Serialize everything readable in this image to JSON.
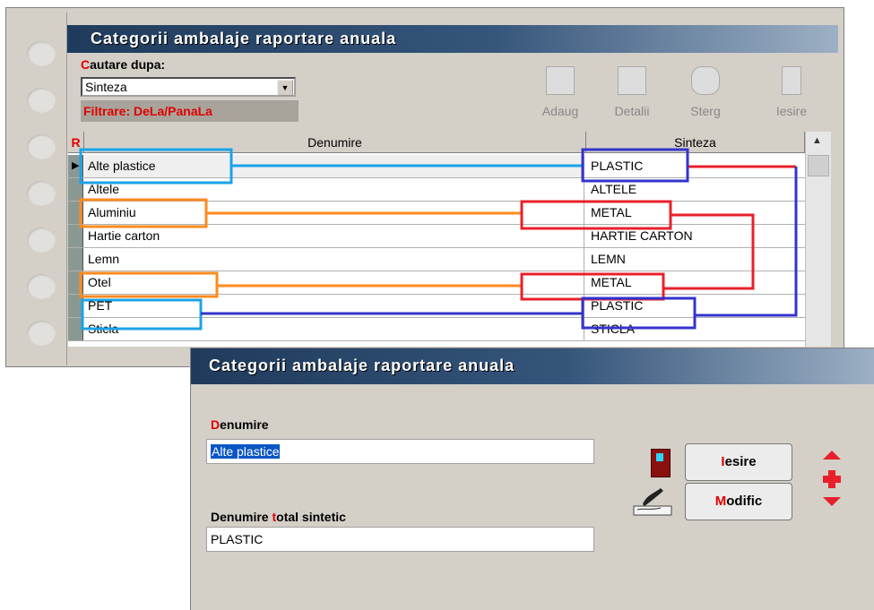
{
  "list_window": {
    "title": "Categorii ambalaje raportare anuala",
    "search": {
      "label_hot": "C",
      "label_rest": "autare dupa:",
      "selected": "Sinteza",
      "filter": "Filtrare: DeLa/PanaLa"
    },
    "toolbar": {
      "add": "Adaug",
      "details": "Detalii",
      "delete": "Sterg",
      "exit": "Iesire"
    },
    "grid": {
      "columns": {
        "mark": "R",
        "name": "Denumire",
        "synth": "Sinteza"
      },
      "rows": [
        {
          "name": "Alte plastice",
          "synth": "PLASTIC"
        },
        {
          "name": "Altele",
          "synth": "ALTELE"
        },
        {
          "name": "Aluminiu",
          "synth": "METAL"
        },
        {
          "name": "Hartie carton",
          "synth": "HARTIE CARTON"
        },
        {
          "name": "Lemn",
          "synth": "LEMN"
        },
        {
          "name": "Otel",
          "synth": "METAL"
        },
        {
          "name": "PET",
          "synth": "PLASTIC"
        },
        {
          "name": "Sticla",
          "synth": "STICLA"
        }
      ]
    }
  },
  "edit_window": {
    "title": "Categorii ambalaje raportare anuala",
    "name_label_hot": "D",
    "name_label_rest": "enumire",
    "name_value": "Alte plastice",
    "synth_label_a": "Denumire ",
    "synth_label_hot": "t",
    "synth_label_b": "otal sintetic",
    "synth_value": "PLASTIC",
    "btn_exit_hot": "I",
    "btn_exit_rest": "esire",
    "btn_modify_hot": "M",
    "btn_modify_rest": "odific"
  },
  "colors": {
    "annotation_blue": "#1aa3e8",
    "annotation_orange": "#ff8a1e",
    "annotation_red": "#e8202a",
    "annotation_navy": "#3333cc"
  }
}
